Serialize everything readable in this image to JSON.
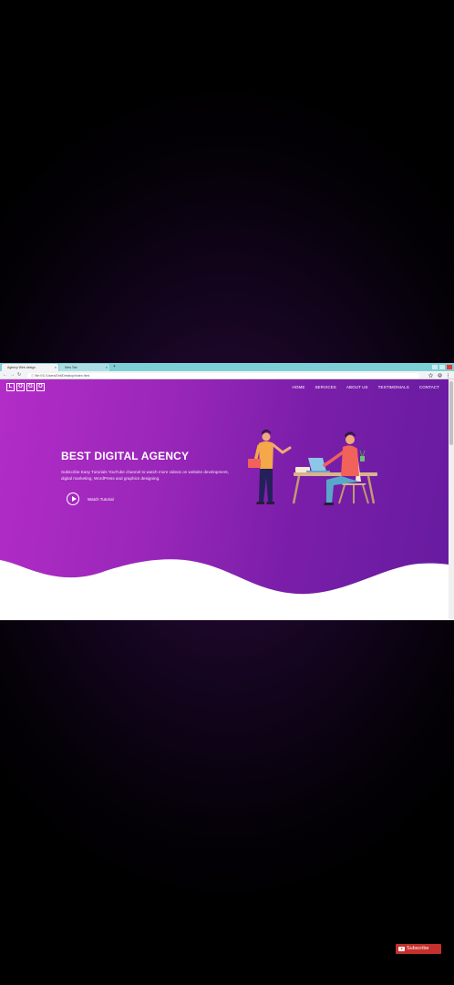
{
  "browser": {
    "tabs": [
      {
        "label": "Agency Web design"
      },
      {
        "label": "New Tab"
      }
    ],
    "new_tab_label": "+",
    "close_label": "×",
    "url": "file:///C:/Users/Dell/Desktop/index.html"
  },
  "site": {
    "logo_letters": [
      "L",
      "O",
      "G",
      "O"
    ],
    "nav": [
      "HOME",
      "SERVICES",
      "ABOUT US",
      "TESTIMONIALS",
      "CONTACT"
    ],
    "headline": "BEST DIGITAL AGENCY",
    "subtext": "Subscribe Easy Tutorials YouTube channel to watch more videos on website development, digital marketing, WordPress and graphics designing.",
    "cta_label": "Watch Tutorial"
  },
  "overlay": {
    "subscribe_label": "Subscribe"
  },
  "colors": {
    "hero_start": "#b32cc8",
    "hero_end": "#661b9f",
    "wave": "#ffffff",
    "subscribe": "#c4302b"
  },
  "icons": [
    "back-arrow-icon",
    "forward-arrow-icon",
    "reload-icon",
    "info-icon",
    "star-icon",
    "profile-icon",
    "menu-dots-icon",
    "play-icon",
    "youtube-icon"
  ]
}
